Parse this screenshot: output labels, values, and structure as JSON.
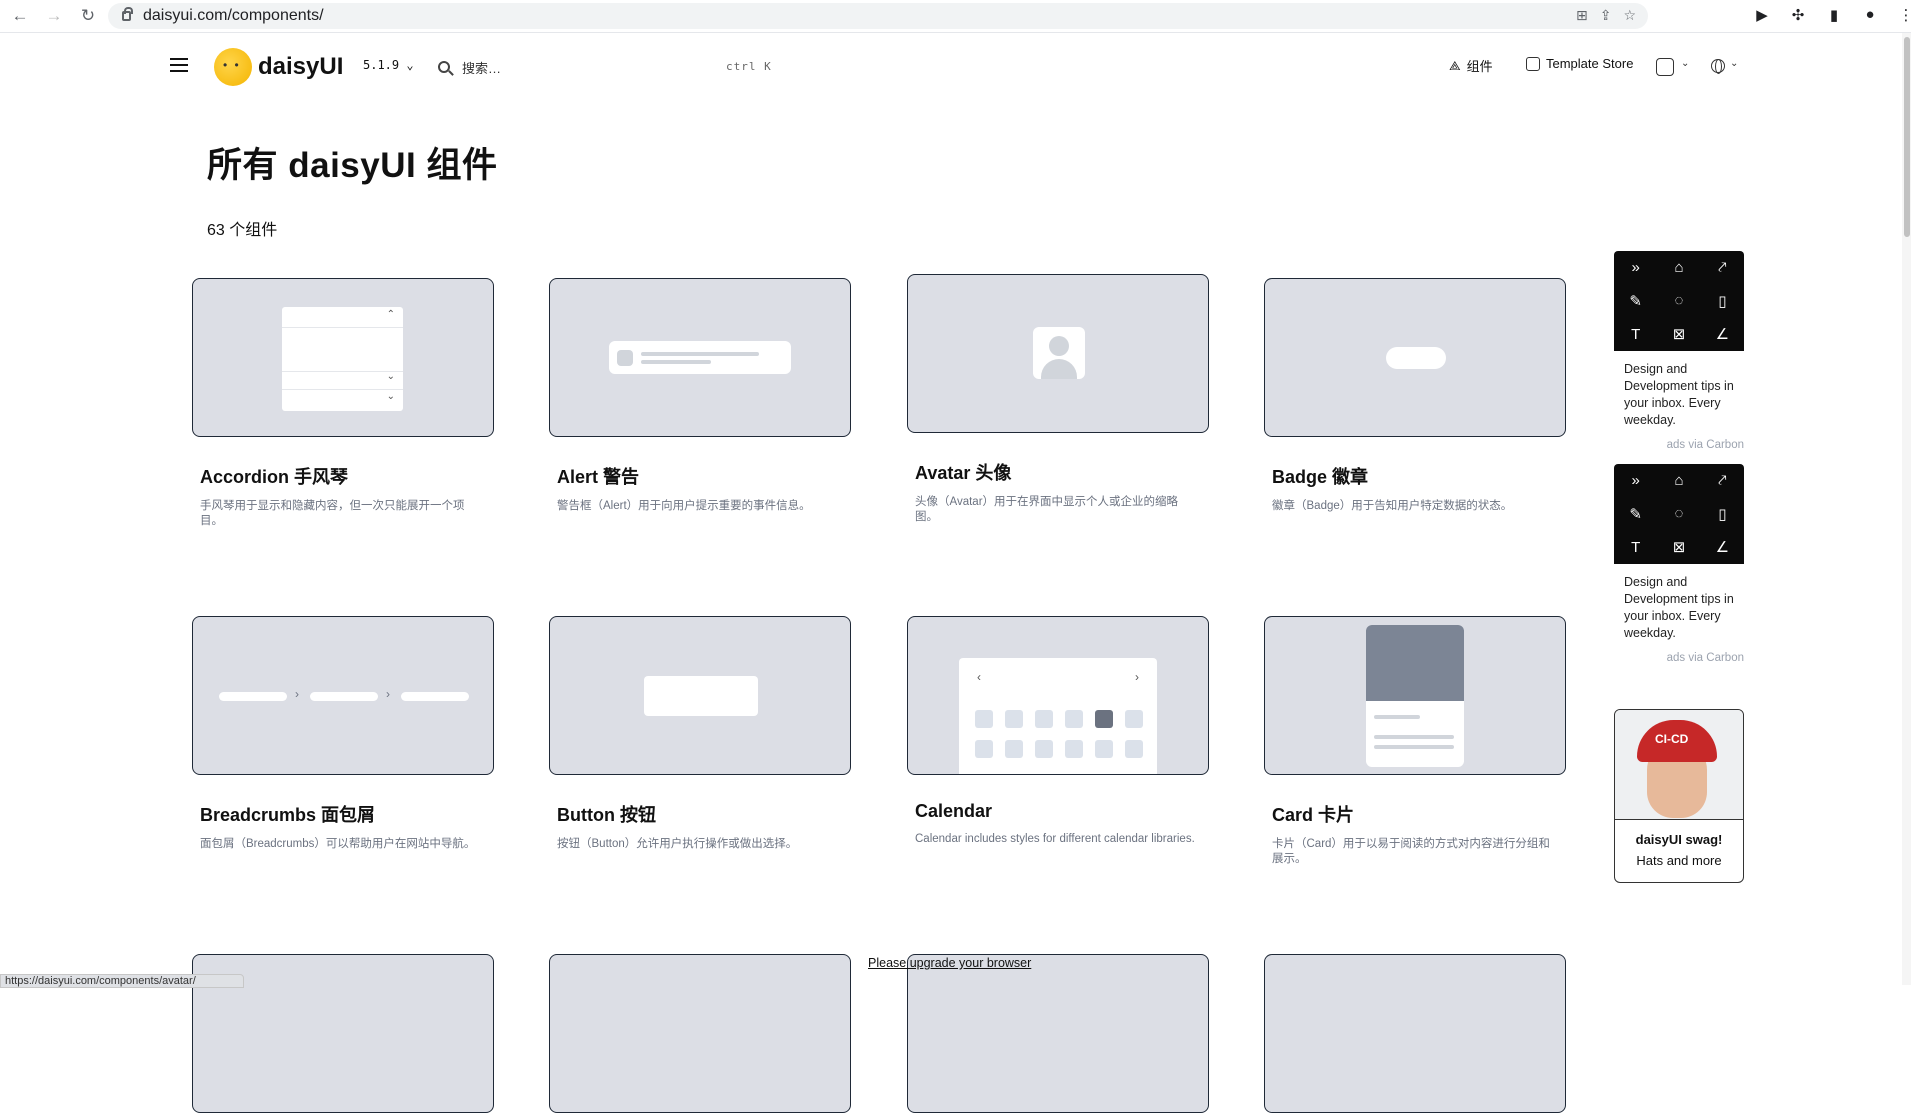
{
  "browser": {
    "url": "daisyui.com/components/",
    "status_url": "https://daisyui.com/components/avatar/"
  },
  "header": {
    "logo_text": "daisyUI",
    "version": "5.1.9",
    "search_placeholder": "搜索…",
    "search_shortcut": "ctrl  K",
    "nav_components": "组件",
    "nav_template_store": "Template Store"
  },
  "page": {
    "title": "所有 daisyUI 组件",
    "count": "63 个组件"
  },
  "components": [
    {
      "title": "Accordion 手风琴",
      "desc": "手风琴用于显示和隐藏内容，但一次只能展开一个项目。"
    },
    {
      "title": "Alert 警告",
      "desc": "警告框（Alert）用于向用户提示重要的事件信息。"
    },
    {
      "title": "Avatar 头像",
      "desc": "头像（Avatar）用于在界面中显示个人或企业的缩略图。"
    },
    {
      "title": "Badge 徽章",
      "desc": "徽章（Badge）用于告知用户特定数据的状态。"
    },
    {
      "title": "Breadcrumbs 面包屑",
      "desc": "面包屑（Breadcrumbs）可以帮助用户在网站中导航。"
    },
    {
      "title": "Button 按钮",
      "desc": "按钮（Button）允许用户执行操作或做出选择。"
    },
    {
      "title": "Calendar",
      "desc": "Calendar includes styles for different calendar libraries."
    },
    {
      "title": "Card 卡片",
      "desc": "卡片（Card）用于以易于阅读的方式对内容进行分组和展示。"
    }
  ],
  "ads": [
    {
      "text": "Design and Development tips in your inbox. Every weekday.",
      "via": "ads via Carbon"
    },
    {
      "text": "Design and Development tips in your inbox. Every weekday.",
      "via": "ads via Carbon"
    }
  ],
  "swag": {
    "title": "daisyUI swag!",
    "subtitle": "Hats and more",
    "cap_text": "CI-CD"
  },
  "footer": {
    "upgrade": "Please upgrade your browser"
  },
  "colors": {
    "accent_card_bg": "#dcdee5",
    "ad_bg": "#0b0b0b"
  }
}
